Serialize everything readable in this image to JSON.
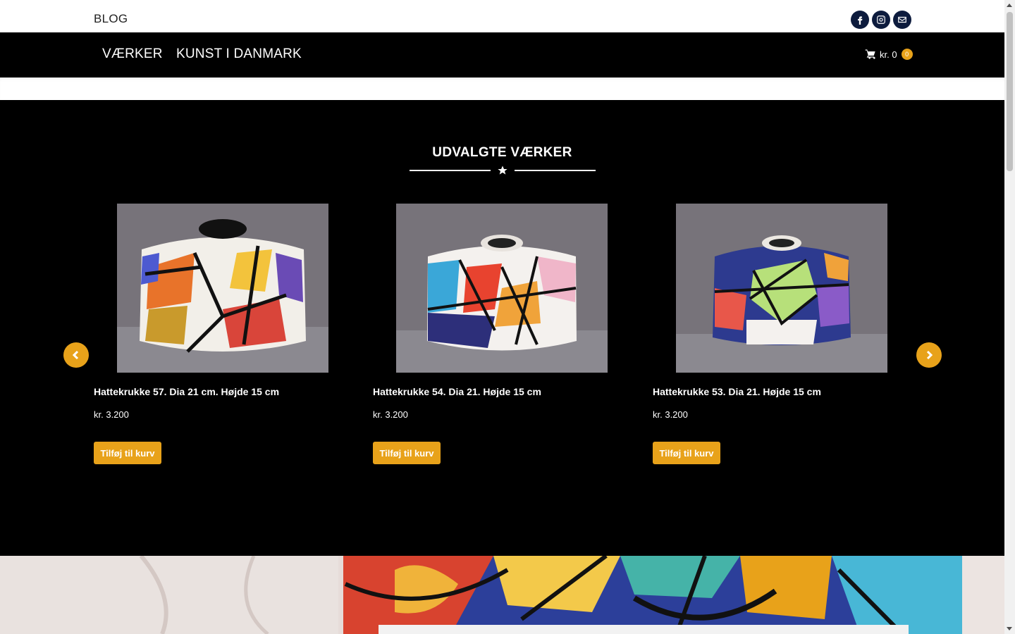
{
  "topbar": {
    "blog": "BLOG",
    "socials": [
      "facebook-icon",
      "instagram-icon",
      "mail-icon"
    ]
  },
  "nav": {
    "items": [
      "VÆRKER",
      "KUNST I DANMARK"
    ]
  },
  "cart": {
    "amount": "kr. 0",
    "count": "0"
  },
  "featured": {
    "title": "UDVALGTE VÆRKER",
    "products": [
      {
        "name": "Hattekrukke 57. Dia 21 cm. Højde 15 cm",
        "price": "kr. 3.200",
        "button": "Tilføj til kurv"
      },
      {
        "name": "Hattekrukke 54. Dia 21. Højde 15 cm",
        "price": "kr. 3.200",
        "button": "Tilføj til kurv"
      },
      {
        "name": "Hattekrukke 53. Dia 21. Højde 15 cm",
        "price": "kr. 3.200",
        "button": "Tilføj til kurv"
      }
    ]
  },
  "colors": {
    "accent": "#e8a21a",
    "nav_bg": "#000000",
    "social_bg": "#0d1b3d"
  }
}
